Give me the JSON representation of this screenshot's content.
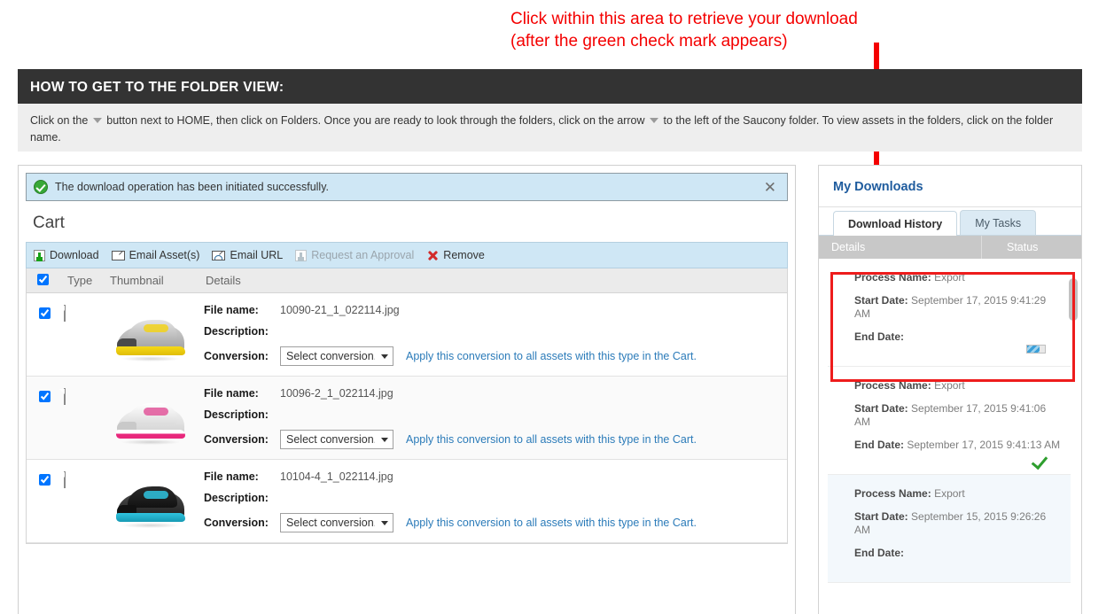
{
  "callout": {
    "line1": "Click within this area to retrieve your download",
    "line2": "(after the green check mark appears)",
    "color": "#f40000"
  },
  "banner": {
    "title": "HOW TO GET TO THE FOLDER VIEW:",
    "text_before_first_icon": "Click on the",
    "text_after_first_icon": "button next to HOME, then click on Folders. Once you are ready to look through the folders, click on the arrow",
    "text_after_second_icon": "to the left of the Saucony folder. To view assets in the folders, click on the folder name.",
    "icon1": "chevron-down-icon",
    "icon2": "chevron-down-icon"
  },
  "notice": {
    "icon": "success-check-icon",
    "message": "The download operation has been initiated successfully.",
    "close_label": "✕"
  },
  "cart": {
    "title": "Cart",
    "toolbar": [
      {
        "label": "Download",
        "icon": "download-icon",
        "disabled": false
      },
      {
        "label": "Email Asset(s)",
        "icon": "envelope-icon",
        "disabled": false
      },
      {
        "label": "Email URL",
        "icon": "envelope-link-icon",
        "disabled": false
      },
      {
        "label": "Request an Approval",
        "icon": "download-icon",
        "disabled": true
      },
      {
        "label": "Remove",
        "icon": "red-x-icon",
        "disabled": false
      }
    ],
    "columns": [
      "",
      "Type",
      "Thumbnail",
      "Details"
    ],
    "header_checkbox_checked": true,
    "labels": {
      "file_name": "File name:",
      "description": "Description:",
      "conversion": "Conversion:"
    },
    "conversion_placeholder": "Select conversion.",
    "apply_link": "Apply this conversion to all assets with this type in the Cart.",
    "rows": [
      {
        "checked": true,
        "type_icon": "image-file-icon",
        "thumbnail": "saucony-grey-yellow-running-shoe",
        "file_name": "10090-21_1_022114.jpg",
        "description": "",
        "conversion": "Select conversion."
      },
      {
        "checked": true,
        "type_icon": "image-file-icon",
        "thumbnail": "saucony-white-pink-running-shoe",
        "file_name": "10096-2_1_022114.jpg",
        "description": "",
        "conversion": "Select conversion."
      },
      {
        "checked": true,
        "type_icon": "image-file-icon",
        "thumbnail": "saucony-black-teal-track-spike",
        "file_name": "10104-4_1_022114.jpg",
        "description": "",
        "conversion": "Select conversion."
      }
    ]
  },
  "downloads": {
    "title": "My Downloads",
    "tabs": [
      {
        "label": "Download History",
        "active": true
      },
      {
        "label": "My Tasks",
        "active": false
      }
    ],
    "columns": {
      "details": "Details",
      "status": "Status"
    },
    "labels": {
      "process_name": "Process Name:",
      "start_date": "Start Date:",
      "end_date": "End Date:"
    },
    "entries": [
      {
        "process_name": "Export",
        "start_date": "September 17, 2015 9:41:29 AM",
        "end_date": "",
        "status_icon": "progress-bar-icon",
        "highlighted": true,
        "tinted": false
      },
      {
        "process_name": "Export",
        "start_date": "September 17, 2015 9:41:06 AM",
        "end_date": "September 17, 2015 9:41:13 AM",
        "status_icon": "green-check-icon",
        "highlighted": false,
        "tinted": false
      },
      {
        "process_name": "Export",
        "start_date": "September 15, 2015 9:26:26 AM",
        "end_date": "",
        "status_icon": "",
        "highlighted": false,
        "tinted": true
      }
    ]
  }
}
